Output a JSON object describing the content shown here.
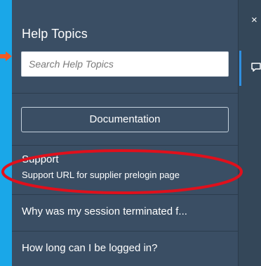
{
  "help": {
    "title": "Help Topics",
    "search_placeholder": "Search Help Topics",
    "documentation_label": "Documentation",
    "topics": [
      {
        "title": "Support",
        "subtitle": "Support URL for supplier prelogin page"
      },
      {
        "title": "Why was my session terminated f..."
      },
      {
        "title": "How long can I be logged in?"
      }
    ]
  },
  "rail": {
    "close_glyph": "×"
  },
  "colors": {
    "background": "#1aa7e8",
    "panel": "#3a4e64",
    "highlight": "#e0101c",
    "accent": "#2f8fe0"
  },
  "icons": [
    "close-icon",
    "chat-icon",
    "arrow-pointer"
  ]
}
